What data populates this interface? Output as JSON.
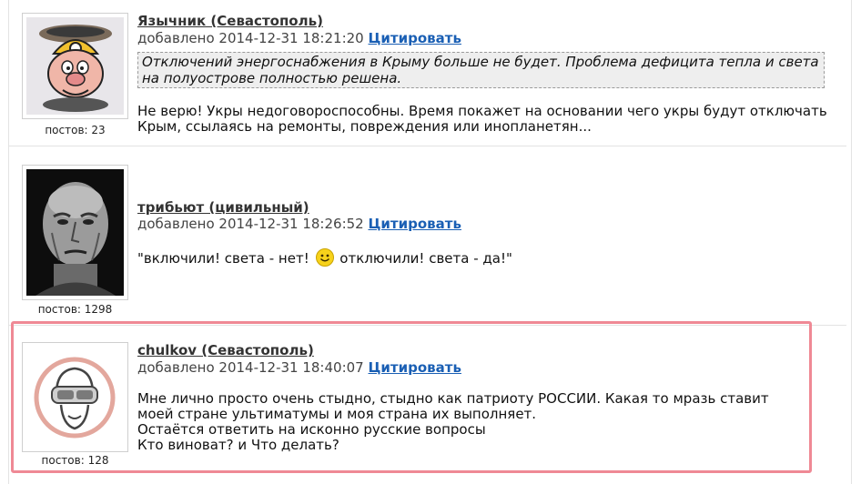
{
  "posts": [
    {
      "author": "Язычник (Севастополь)",
      "added_label": "добавлено 2014-12-31 18:21:20",
      "quote_label": "Цитировать",
      "post_count": "постов: 23",
      "quote": "Отключений энергоснабжения в Крыму больше не будет. Проблема дефицита тепла и света на полуострове полностью решена.",
      "text": "Не верю! Укры недоговороспособны. Время покажет на основании чего укры будут отключать Крым, ссылаясь на ремонты, повреждения или инопланетян...",
      "avatar_icon": "miner-pig-icon"
    },
    {
      "author": "трибьют (цивильный)",
      "added_label": "добавлено 2014-12-31 18:26:52",
      "quote_label": "Цитировать",
      "post_count": "постов: 1298",
      "text_before": "\"включили! света - нет!",
      "text_after": "отключили! света - да!\"",
      "avatar_icon": "old-man-portrait-icon"
    },
    {
      "author": "chulkov (Севастополь)",
      "added_label": "добавлено 2014-12-31 18:40:07",
      "quote_label": "Цитировать",
      "post_count": "постов: 128",
      "lines": [
        "Мне лично просто очень стыдно, стыдно как патриоту РОССИИ. Какая то мразь ставит моей стране ультиматумы и моя страна их выполняет.",
        "Остаётся ответить на исконно русские вопросы",
        "Кто виноват? и Что делать?"
      ],
      "avatar_icon": "goggles-face-icon"
    }
  ],
  "colors": {
    "link": "#1a5fb4",
    "highlight_border": "#ef8995",
    "quote_bg": "#eeeeee"
  }
}
